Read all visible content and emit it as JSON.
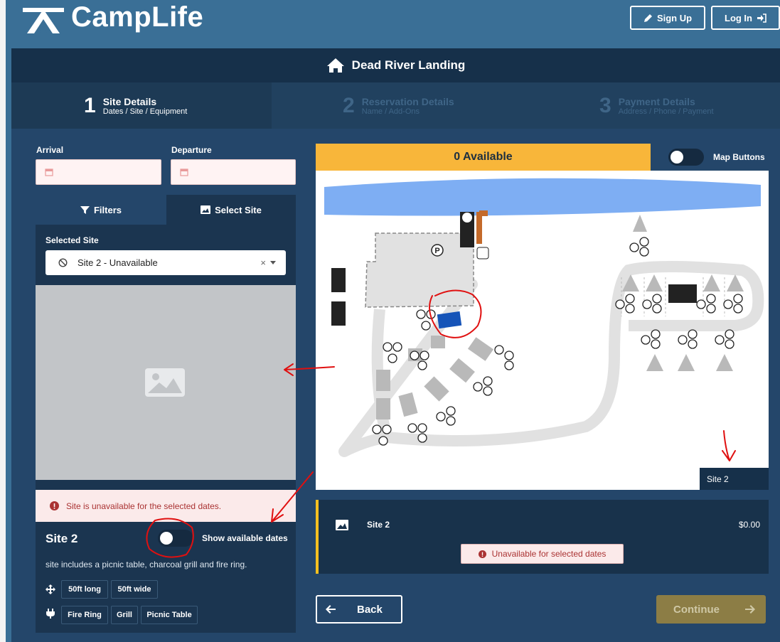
{
  "header": {
    "logo_text": "CampLife",
    "signup_label": "Sign Up",
    "login_label": "Log In"
  },
  "park_title": "Dead River Landing",
  "steps": [
    {
      "num": "1",
      "title": "Site Details",
      "sub": "Dates / Site / Equipment",
      "active": true
    },
    {
      "num": "2",
      "title": "Reservation Details",
      "sub": "Name / Add-Ons",
      "active": false
    },
    {
      "num": "3",
      "title": "Payment Details",
      "sub": "Address / Phone / Payment",
      "active": false
    }
  ],
  "dates": {
    "arrival_label": "Arrival",
    "departure_label": "Departure"
  },
  "tabs": {
    "filters": "Filters",
    "select_site": "Select Site"
  },
  "selected_site": {
    "label": "Selected Site",
    "value": "Site 2 - Unavailable",
    "clear": "×"
  },
  "alert": "Site is unavailable for the selected dates.",
  "site": {
    "name": "Site 2",
    "toggle_label": "Show available dates",
    "description": "site includes a picnic table, charcoal grill and fire ring.",
    "size_chips": [
      "50ft long",
      "50ft wide"
    ],
    "amenity_chips": [
      "Fire Ring",
      "Grill",
      "Picnic Table"
    ]
  },
  "map_header": {
    "available": "0 Available",
    "map_buttons": "Map Buttons"
  },
  "map": {
    "tooltip": "Site 2",
    "parking_letter": "P"
  },
  "site_card": {
    "name": "Site 2",
    "price": "$0.00",
    "status": "Unavailable for selected dates"
  },
  "nav": {
    "back": "Back",
    "continue": "Continue"
  },
  "colors": {
    "background": "#3a6f96",
    "navy": "#16304a",
    "accent_yellow": "#f8b63a",
    "water": "#7eaef3",
    "selected_site": "#1654b8",
    "error": "#a33333",
    "annotation": "#e01010"
  }
}
